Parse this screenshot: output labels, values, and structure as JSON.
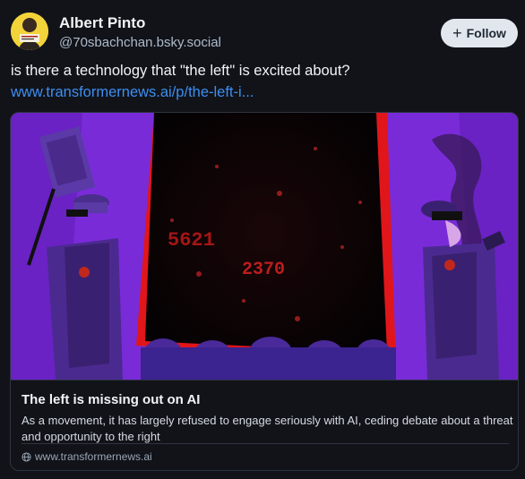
{
  "author": {
    "display_name": "Albert Pinto",
    "handle": "@70sbachchan.bsky.social"
  },
  "follow_button": {
    "label": "Follow",
    "icon": "plus-icon"
  },
  "post": {
    "text": "is there a technology that \"the left\" is excited about?",
    "link": "www.transformernews.ai/p/the-left-i..."
  },
  "link_card": {
    "title": "The left is missing out on AI",
    "description": "As a movement, it has largely refused to engage seriously with AI, ceding debate about a threat and opportunity to the right",
    "domain": "www.transformernews.ai",
    "domain_icon": "globe-icon",
    "image_numbers": [
      "5621",
      "2370"
    ]
  },
  "colors": {
    "background": "#111319",
    "link": "#3d8ef0",
    "follow_bg": "#e2e7ee",
    "image_purple": "#7a2bd8",
    "image_red": "#e0161a"
  }
}
